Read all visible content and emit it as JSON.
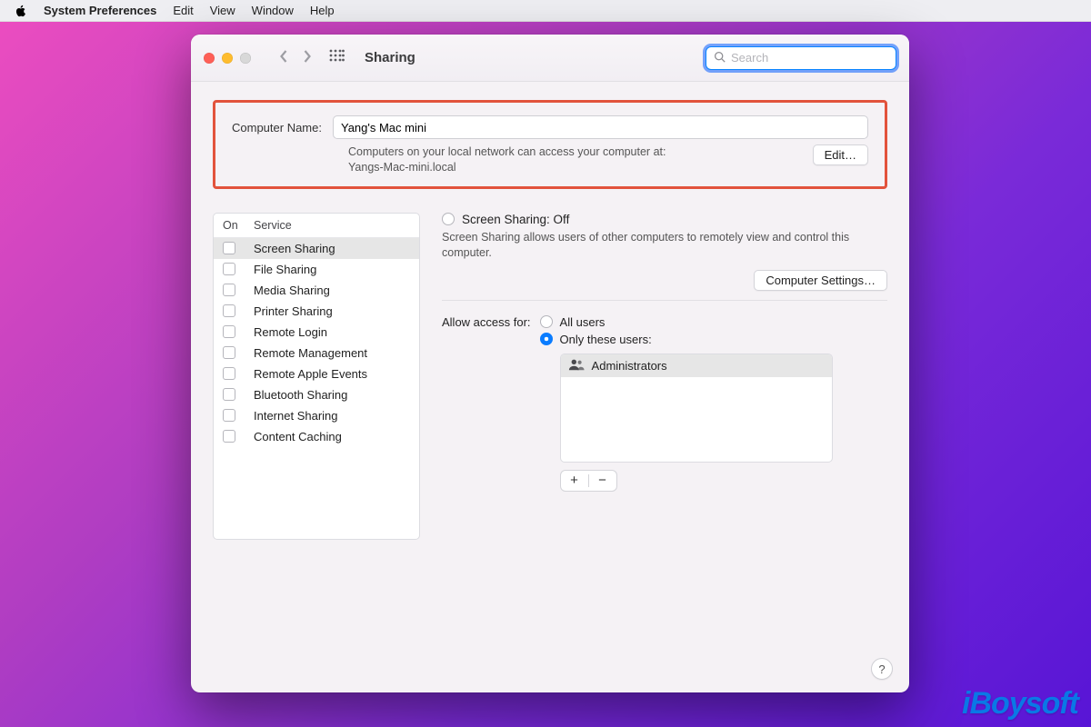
{
  "menubar": {
    "app_name": "System Preferences",
    "items": [
      "Edit",
      "View",
      "Window",
      "Help"
    ]
  },
  "toolbar": {
    "title": "Sharing",
    "search_placeholder": "Search"
  },
  "computer_name": {
    "label": "Computer Name:",
    "value": "Yang's Mac mini",
    "subtext": "Computers on your local network can access your computer at:",
    "hostname": "Yangs-Mac-mini.local",
    "edit_label": "Edit…"
  },
  "services": {
    "columns": {
      "on": "On",
      "service": "Service"
    },
    "items": [
      {
        "label": "Screen Sharing",
        "checked": false,
        "selected": true
      },
      {
        "label": "File Sharing",
        "checked": false,
        "selected": false
      },
      {
        "label": "Media Sharing",
        "checked": false,
        "selected": false
      },
      {
        "label": "Printer Sharing",
        "checked": false,
        "selected": false
      },
      {
        "label": "Remote Login",
        "checked": false,
        "selected": false
      },
      {
        "label": "Remote Management",
        "checked": false,
        "selected": false
      },
      {
        "label": "Remote Apple Events",
        "checked": false,
        "selected": false
      },
      {
        "label": "Bluetooth Sharing",
        "checked": false,
        "selected": false
      },
      {
        "label": "Internet Sharing",
        "checked": false,
        "selected": false
      },
      {
        "label": "Content Caching",
        "checked": false,
        "selected": false
      }
    ]
  },
  "detail": {
    "heading": "Screen Sharing: Off",
    "description": "Screen Sharing allows users of other computers to remotely view and control this computer.",
    "computer_settings_label": "Computer Settings…",
    "access_label": "Allow access for:",
    "options": {
      "all_users": "All users",
      "only_these": "Only these users:"
    },
    "selected_option": "only_these",
    "users": [
      "Administrators"
    ]
  },
  "help_label": "?",
  "watermark": "iBoysoft"
}
